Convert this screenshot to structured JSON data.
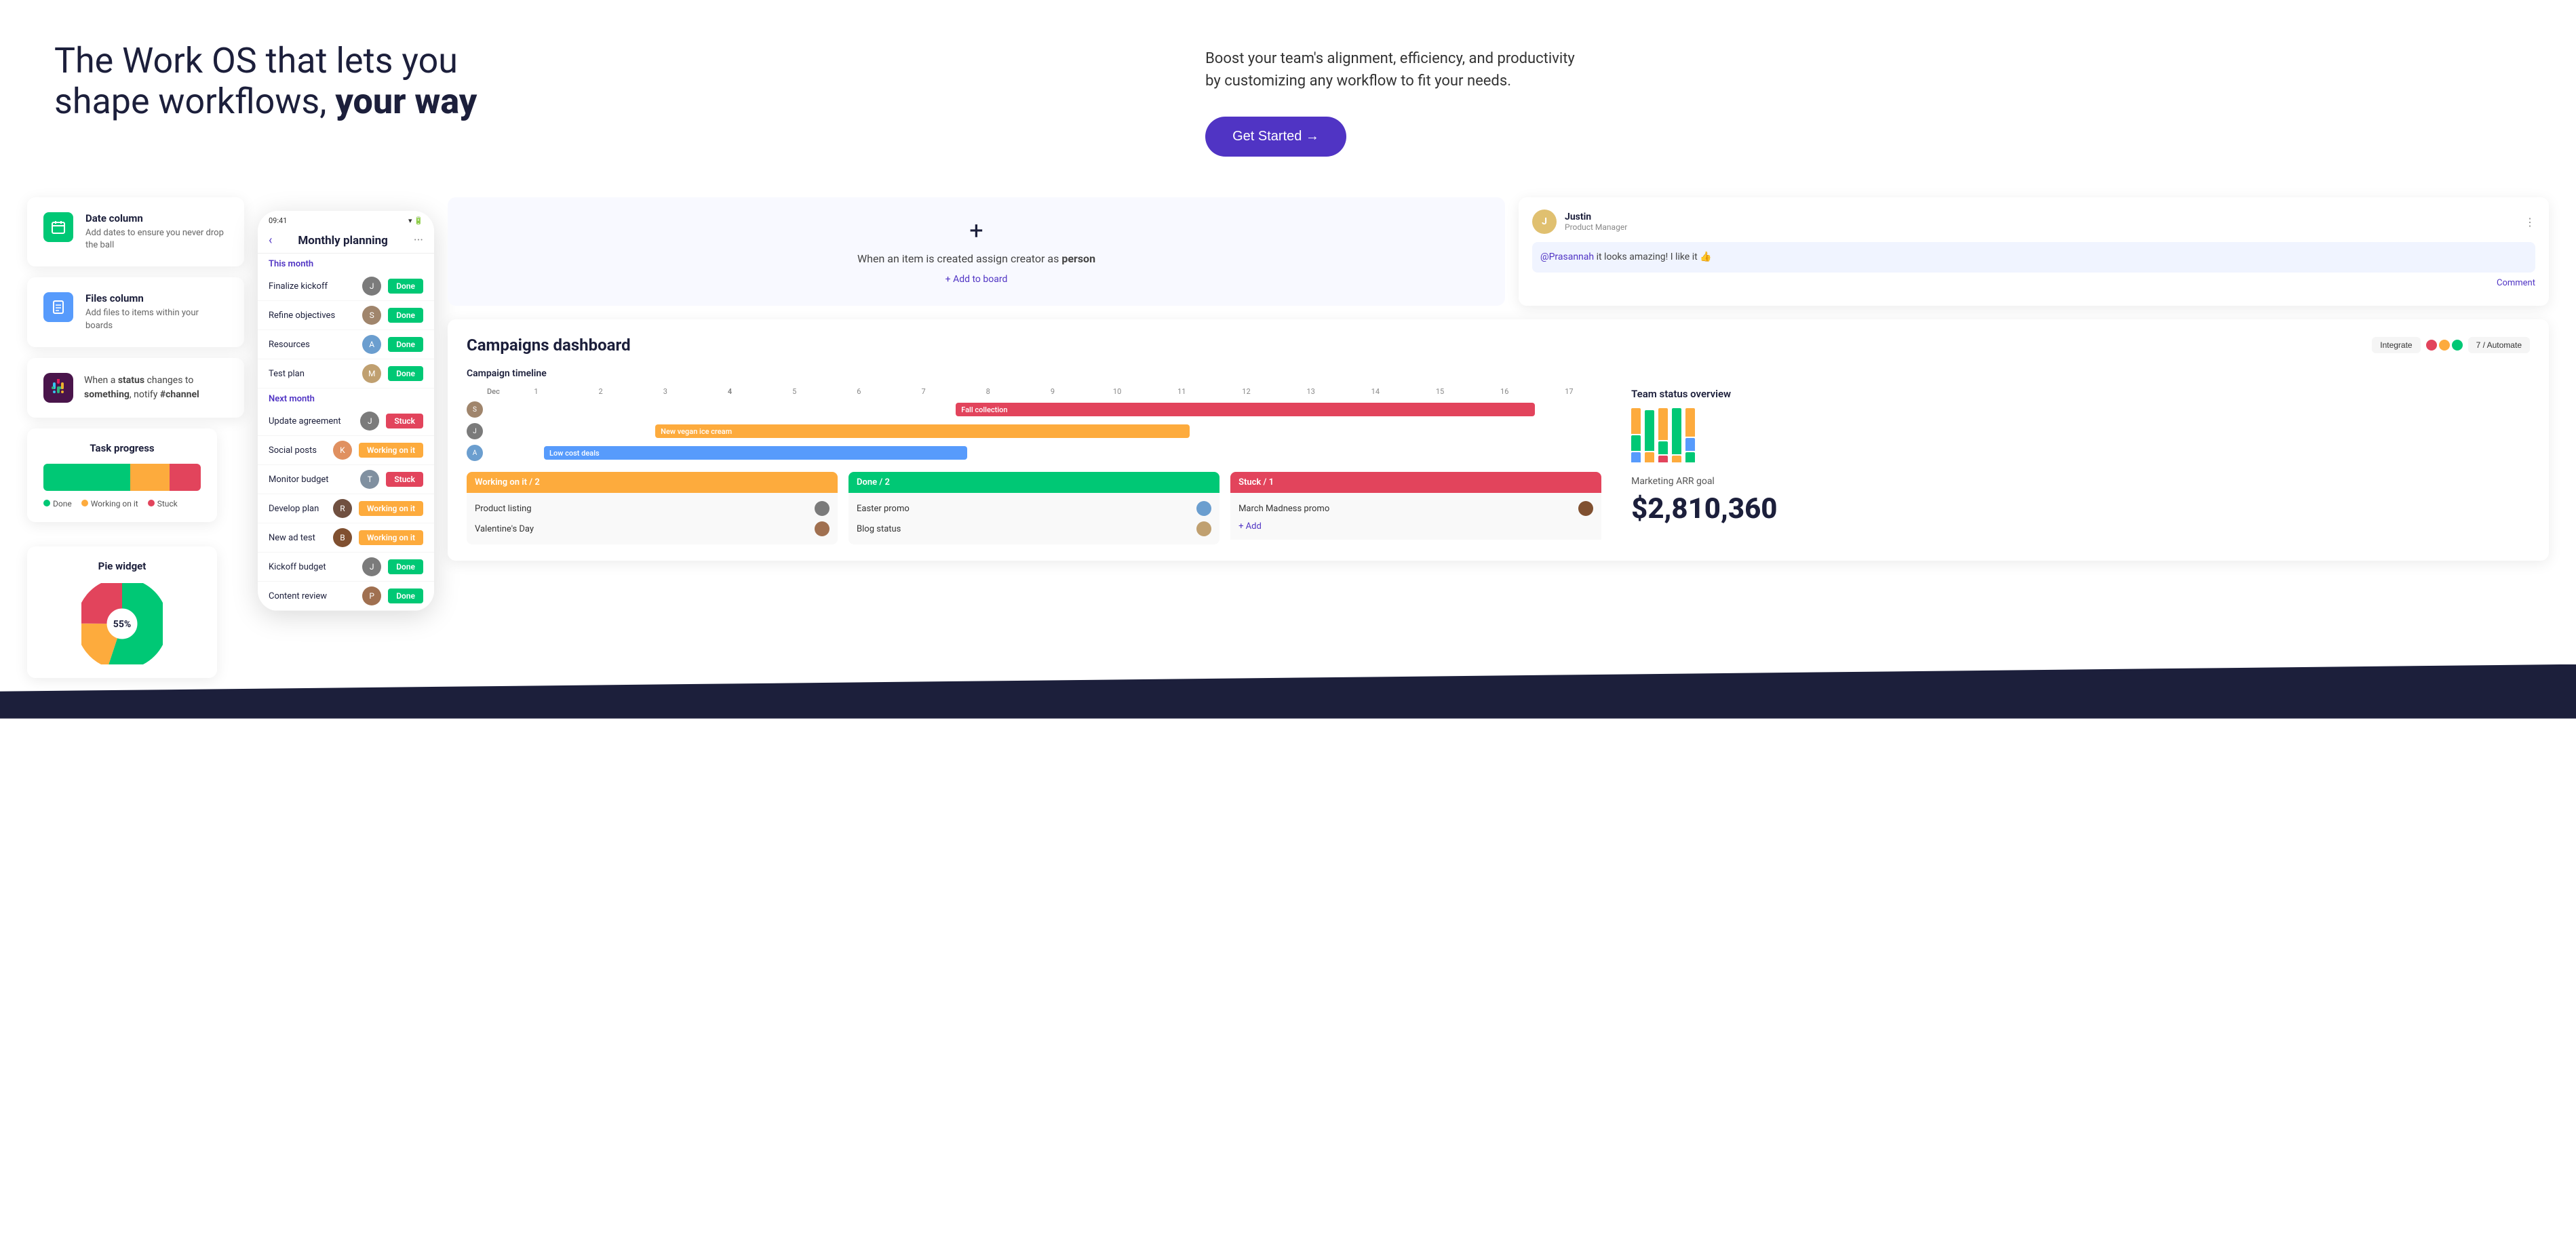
{
  "hero": {
    "title_part1": "The Work OS that lets you",
    "title_part2": "shape workflows, ",
    "title_bold": "your way",
    "subtitle": "Boost your team's alignment, efficiency, and productivity by customizing any workflow to fit your needs.",
    "cta_label": "Get Started →"
  },
  "features": {
    "date_column": {
      "title": "Date column",
      "description": "Add dates to ensure you never drop the ball",
      "icon_color": "#00c875"
    },
    "files_column": {
      "title": "Files column",
      "description": "Add files to items within your boards",
      "icon_color": "#579bfc"
    },
    "automation": {
      "text_before": "When a ",
      "bold1": "status",
      "text_middle": " changes to ",
      "bold2": "something",
      "text_after": ", notify ",
      "bold3": "#channel"
    }
  },
  "task_progress": {
    "title": "Task progress",
    "done_pct": 55,
    "working_pct": 25,
    "stuck_pct": 20,
    "done_color": "#00c875",
    "working_color": "#fdab3d",
    "stuck_color": "#e2445c",
    "legend_done": "Done",
    "legend_working": "Working on it",
    "legend_stuck": "Stuck"
  },
  "pie_widget": {
    "title": "Pie widget",
    "center_label": "55%",
    "slices": [
      {
        "color": "#00c875",
        "pct": 55
      },
      {
        "color": "#fdab3d",
        "pct": 20
      },
      {
        "color": "#e2445c",
        "pct": 25
      }
    ]
  },
  "phone": {
    "time": "09:41",
    "title": "Monthly planning",
    "section_this_month": "This month",
    "section_next_month": "Next month",
    "rows": [
      {
        "name": "Finalize kickoff",
        "status": "Done",
        "status_class": "status-done",
        "avatar_bg": "#7b7b7b"
      },
      {
        "name": "Refine objectives",
        "status": "Done",
        "status_class": "status-done",
        "avatar_bg": "#a0856c"
      },
      {
        "name": "Resources",
        "status": "Done",
        "status_class": "status-done",
        "avatar_bg": "#6b9ecf"
      },
      {
        "name": "Test plan",
        "status": "Done",
        "status_class": "status-done",
        "avatar_bg": "#c0a070"
      },
      {
        "name": "Update agreement",
        "status": "Stuck",
        "status_class": "status-stuck",
        "avatar_bg": "#7b7b7b"
      },
      {
        "name": "Social posts",
        "status": "Working on it",
        "status_class": "status-working",
        "avatar_bg": "#e09060"
      },
      {
        "name": "Monitor budget",
        "status": "Stuck",
        "status_class": "status-stuck",
        "avatar_bg": "#8090a0"
      },
      {
        "name": "Develop plan",
        "status": "Working on it",
        "status_class": "status-working",
        "avatar_bg": "#705040"
      },
      {
        "name": "New ad test",
        "status": "Working on it",
        "status_class": "status-working",
        "avatar_bg": "#805030"
      },
      {
        "name": "Kickoff budget",
        "status": "Done",
        "status_class": "status-done",
        "avatar_bg": "#7b7b7b"
      },
      {
        "name": "Content review",
        "status": "Done",
        "status_class": "status-done",
        "avatar_bg": "#a07050"
      }
    ]
  },
  "automation_info": {
    "text": "When an item is created assign creator as ",
    "bold": "person",
    "link": "+ Add to board"
  },
  "comment": {
    "user": "Justin",
    "role": "Product Manager",
    "mention": "@Prasannah",
    "body_after": " it looks amazing! I like it 👍",
    "action": "Comment"
  },
  "campaigns": {
    "title": "Campaigns dashboard",
    "integrate_label": "Integrate",
    "automate_label": "7 / Automate",
    "timeline_title": "Campaign timeline",
    "timeline_months": [
      "Dec",
      "1",
      "2",
      "3",
      "4",
      "5",
      "6",
      "7",
      "8",
      "9",
      "10",
      "11",
      "12",
      "13",
      "14",
      "15",
      "16",
      "17"
    ],
    "timeline_bars": [
      {
        "label": "Fall collection",
        "color": "#e2445c",
        "left_pct": 40,
        "width_pct": 55
      },
      {
        "label": "New vegan ice cream",
        "color": "#fdab3d",
        "left_pct": 18,
        "width_pct": 42
      },
      {
        "label": "Low cost deals",
        "color": "#579bfc",
        "left_pct": 8,
        "width_pct": 35
      }
    ],
    "arr_label": "Marketing ARR goal",
    "arr_value": "$2,810,360",
    "status_cols": [
      {
        "label": "Working on it / 2",
        "color": "#fdab3d",
        "items": [
          "Product listing",
          "Valentine's Day"
        ]
      },
      {
        "label": "Done / 2",
        "color": "#00c875",
        "items": [
          "Easter promo",
          "Blog status"
        ]
      },
      {
        "label": "Stuck / 1",
        "color": "#e2445c",
        "items": [
          "March Madness promo",
          "Add"
        ]
      }
    ]
  },
  "icons": {
    "calendar": "📅",
    "file": "📄",
    "slack": "#",
    "back": "‹",
    "dots": "···"
  }
}
